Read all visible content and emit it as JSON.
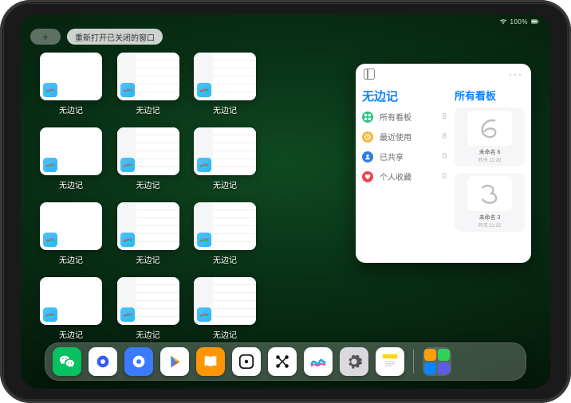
{
  "status": {
    "battery": "100%"
  },
  "topbar": {
    "plus_label": "+",
    "reopen_label": "重新打开已关闭的窗口"
  },
  "app_name": "无边记",
  "cards": [
    {
      "label": "无边记",
      "variant": "blank"
    },
    {
      "label": "无边记",
      "variant": "calendar"
    },
    {
      "label": "无边记",
      "variant": "calendar"
    },
    {
      "label": "无边记",
      "variant": "blank"
    },
    {
      "label": "无边记",
      "variant": "calendar"
    },
    {
      "label": "无边记",
      "variant": "calendar"
    },
    {
      "label": "无边记",
      "variant": "blank"
    },
    {
      "label": "无边记",
      "variant": "calendar"
    },
    {
      "label": "无边记",
      "variant": "calendar"
    },
    {
      "label": "无边记",
      "variant": "blank"
    },
    {
      "label": "无边记",
      "variant": "calendar"
    },
    {
      "label": "无边记",
      "variant": "calendar"
    }
  ],
  "preview": {
    "title": "无边记",
    "right_title": "所有看板",
    "header_icon": "sidebar-icon",
    "more": "···",
    "menu": [
      {
        "icon": "grid",
        "color": "#2ec27e",
        "label": "所有看板",
        "count": "8"
      },
      {
        "icon": "clock",
        "color": "#f6b73c",
        "label": "最近使用",
        "count": "8"
      },
      {
        "icon": "person",
        "color": "#2f7de1",
        "label": "已共享",
        "count": "0"
      },
      {
        "icon": "heart",
        "color": "#e84855",
        "label": "个人收藏",
        "count": "0"
      }
    ],
    "boards": [
      {
        "label": "未命名 6",
        "ts": "昨天 11:28",
        "scribble": "6"
      },
      {
        "label": "未命名 3",
        "ts": "昨天 11:25",
        "scribble": "3"
      }
    ]
  },
  "dock": [
    {
      "name": "wechat",
      "bg": "#07c160",
      "icon": "wechat"
    },
    {
      "name": "quark-hd",
      "bg": "#ffffff",
      "icon": "quark-blue"
    },
    {
      "name": "quark",
      "bg": "#3a7bff",
      "icon": "quark-white"
    },
    {
      "name": "play",
      "bg": "#ffffff",
      "icon": "play"
    },
    {
      "name": "books",
      "bg": "#ff9500",
      "icon": "books"
    },
    {
      "name": "dice",
      "bg": "#ffffff",
      "icon": "dice"
    },
    {
      "name": "nodes",
      "bg": "#ffffff",
      "icon": "nodes"
    },
    {
      "name": "freeform",
      "bg": "#ffffff",
      "icon": "freeform"
    },
    {
      "name": "settings",
      "bg": "#d9d9de",
      "icon": "gear"
    },
    {
      "name": "notes",
      "bg": "#ffffff",
      "icon": "notes"
    }
  ],
  "suggested": [
    "#ff9f0a",
    "#30d158",
    "#0a84ff",
    "#5e5ce6"
  ]
}
